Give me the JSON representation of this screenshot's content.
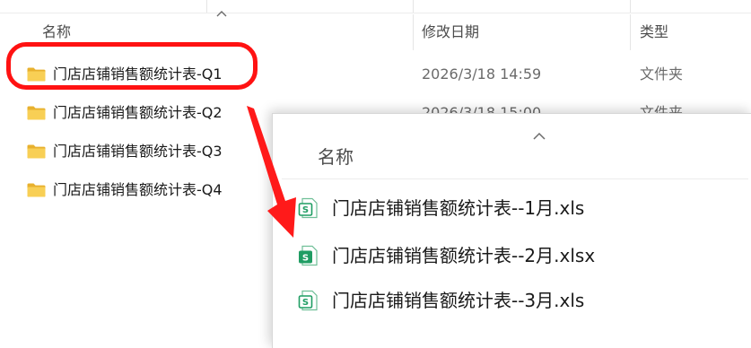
{
  "explorer": {
    "columns": {
      "name": "名称",
      "modified": "修改日期",
      "type": "类型"
    },
    "rows": [
      {
        "name": "门店店铺销售额统计表-Q1",
        "modified": "2026/3/18 14:59",
        "type": "文件夹",
        "highlighted": true
      },
      {
        "name": "门店店铺销售额统计表-Q2",
        "modified": "2026/3/18 15:00",
        "type": "文件夹",
        "highlighted": false
      },
      {
        "name": "门店店铺销售额统计表-Q3",
        "modified": "",
        "type": "",
        "highlighted": false
      },
      {
        "name": "门店店铺销售额统计表-Q4",
        "modified": "",
        "type": "",
        "highlighted": false
      }
    ]
  },
  "popup": {
    "column_name": "名称",
    "files": [
      {
        "name": "门店店铺销售额统计表--1月.xls",
        "icon": "spreadsheet-outline-icon"
      },
      {
        "name": "门店店铺销售额统计表--2月.xlsx",
        "icon": "spreadsheet-filled-icon"
      },
      {
        "name": "门店店铺销售额统计表--3月.xls",
        "icon": "spreadsheet-outline-icon"
      }
    ]
  },
  "colors": {
    "highlight": "#ff1212",
    "folder": "#f6c748",
    "spreadsheet": "#1f9d63"
  }
}
